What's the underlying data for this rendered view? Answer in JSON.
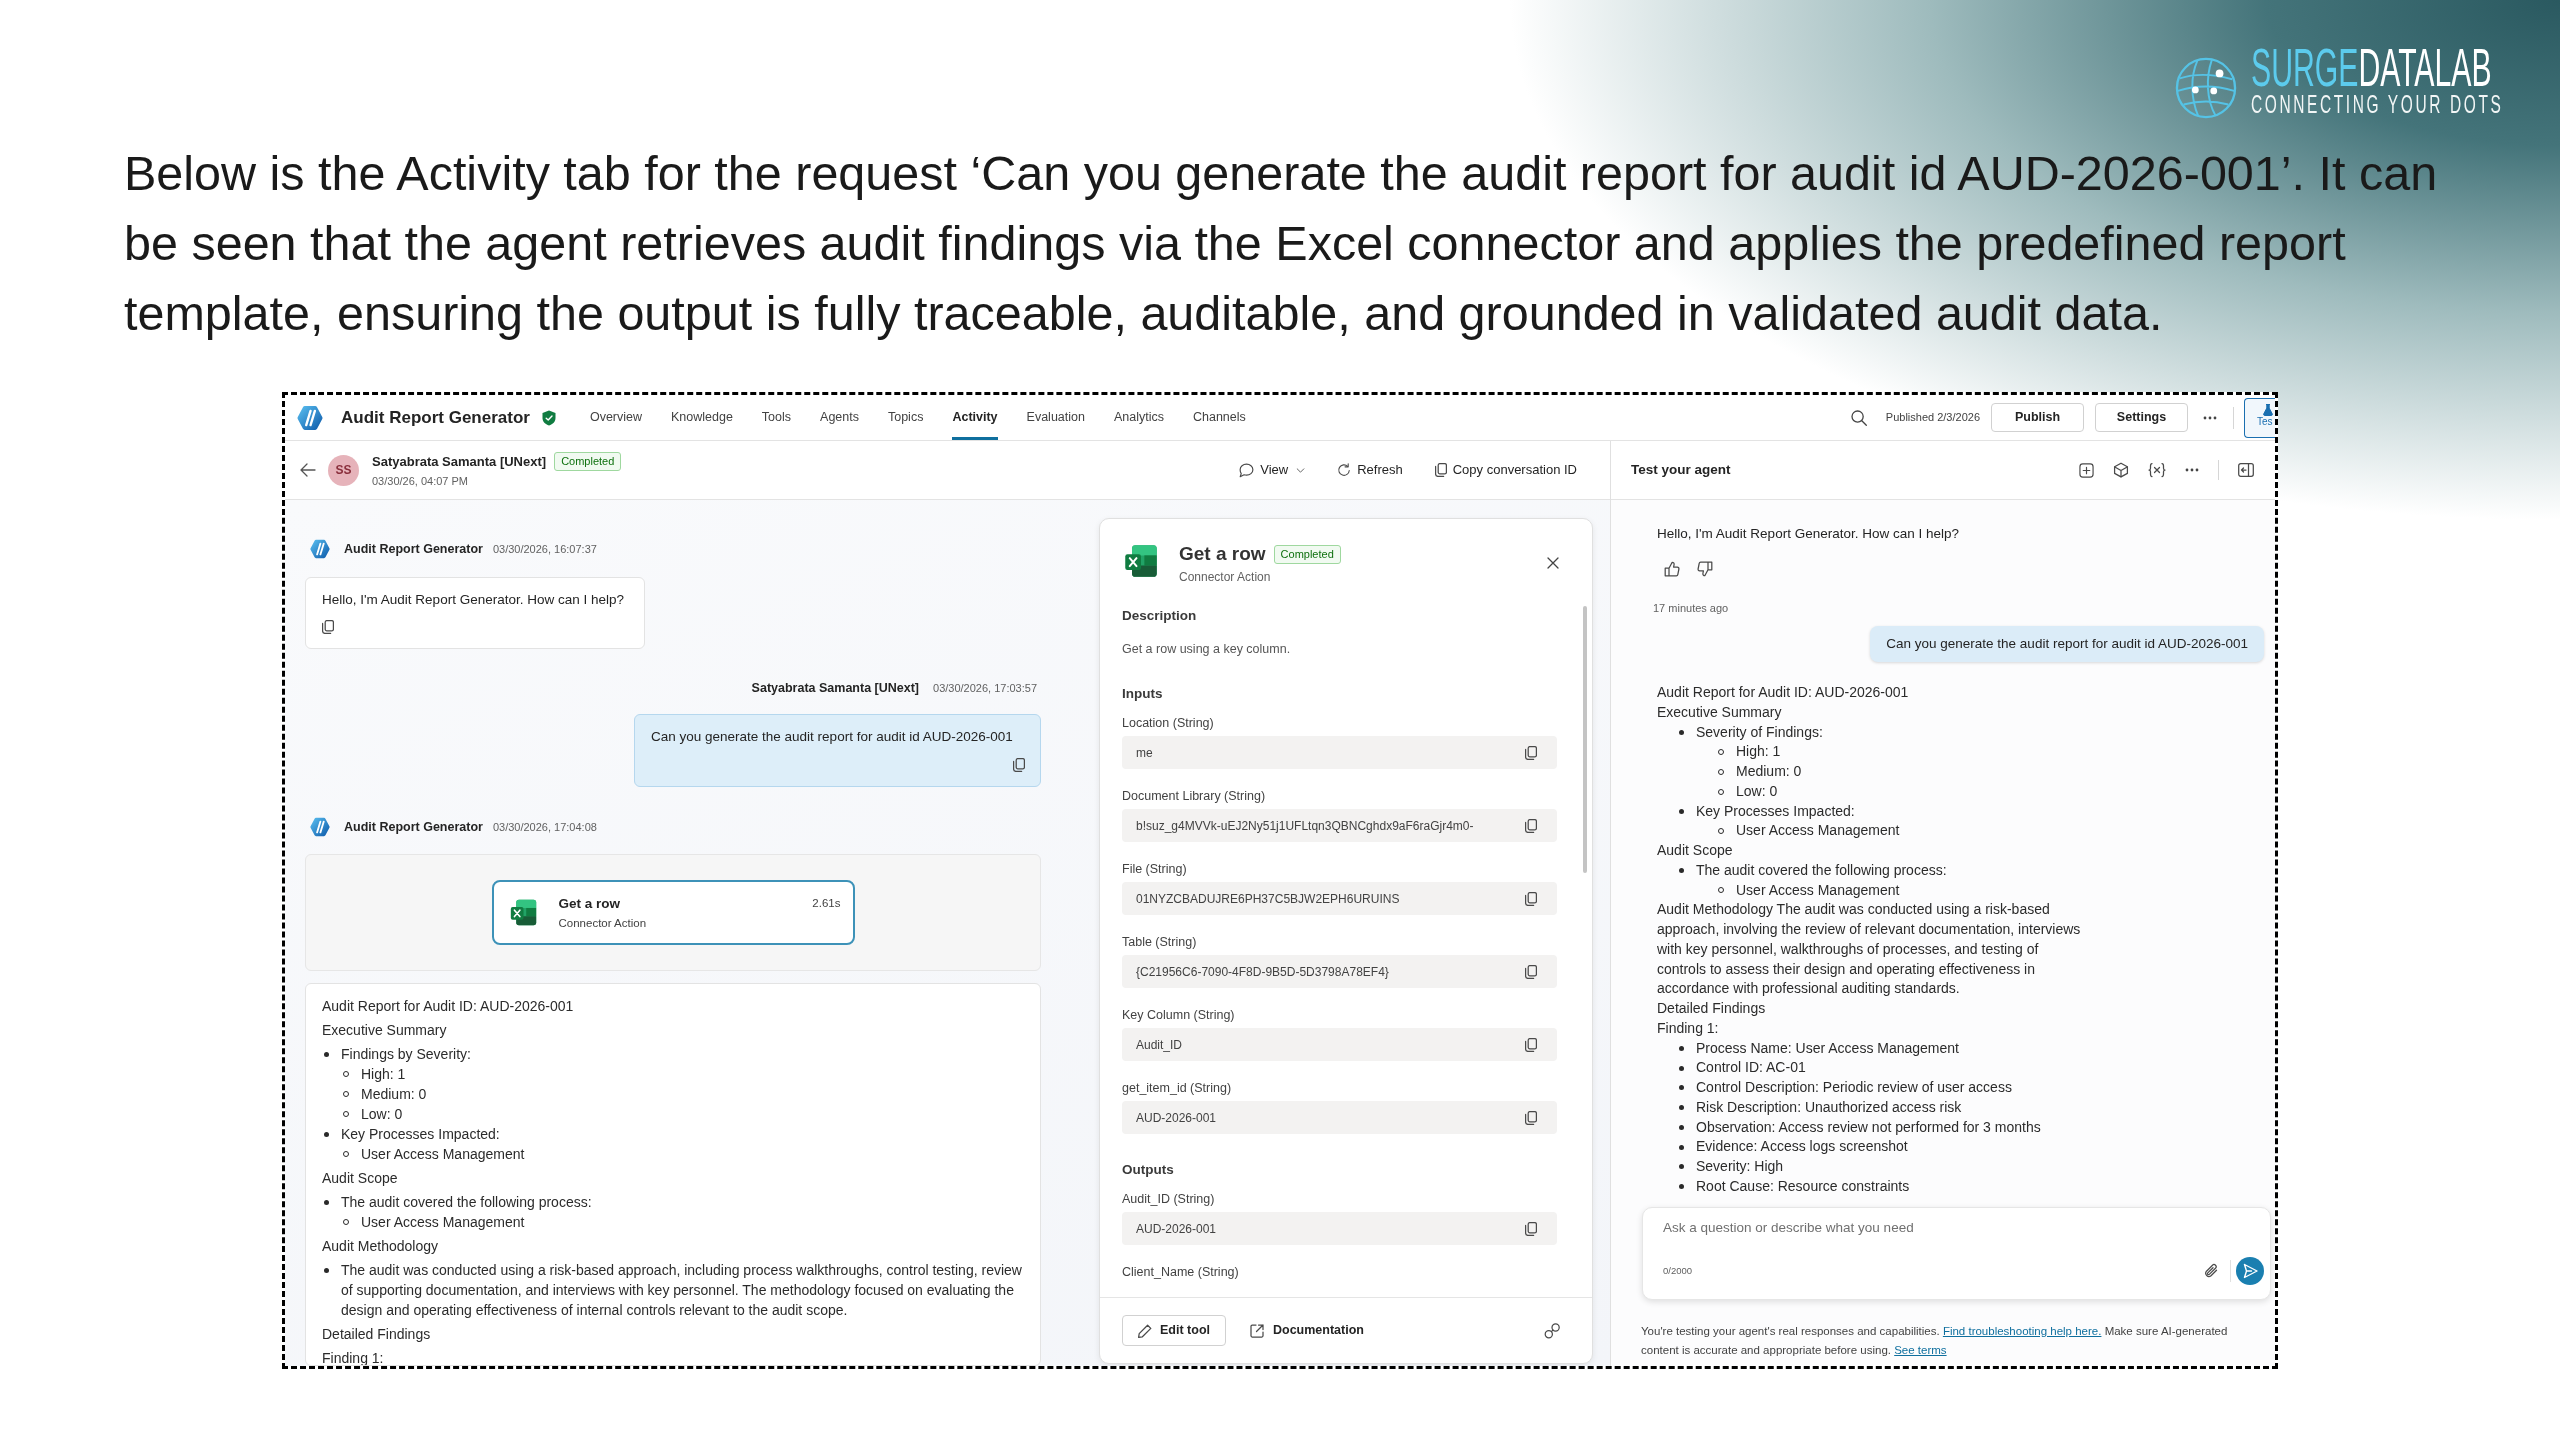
{
  "slide": {
    "caption": "Below is the Activity tab for the request ‘Can you generate the audit report for audit id AUD-2026-001’. It can be seen that the agent retrieves audit findings via the Excel connector and applies the predefined report template, ensuring the output is fully traceable, auditable, and grounded in validated audit data."
  },
  "logo": {
    "brand_1": "SURGE",
    "brand_2": "DATALAB",
    "tagline": "CONNECTING YOUR DOTS"
  },
  "app": {
    "title": "Audit Report Generator",
    "tabs": [
      {
        "label": "Overview",
        "selected": false
      },
      {
        "label": "Knowledge",
        "selected": false
      },
      {
        "label": "Tools",
        "selected": false
      },
      {
        "label": "Agents",
        "selected": false
      },
      {
        "label": "Topics",
        "selected": false
      },
      {
        "label": "Activity",
        "selected": true
      },
      {
        "label": "Evaluation",
        "selected": false
      },
      {
        "label": "Analytics",
        "selected": false
      },
      {
        "label": "Channels",
        "selected": false
      }
    ],
    "published": "Published 2/3/2026",
    "buttons": [
      {
        "label": "Publish"
      },
      {
        "label": "Settings"
      }
    ],
    "test_button": {
      "label": "Tes",
      "active": true
    }
  },
  "conversation": {
    "initials": "SS",
    "user": "Satyabrata Samanta [UNext]",
    "status": "Completed",
    "date": "03/30/26, 04:07 PM",
    "actions": [
      {
        "kind": "view",
        "label": "View"
      },
      {
        "kind": "refresh",
        "label": "Refresh"
      },
      {
        "kind": "copy",
        "label": "Copy conversation ID"
      }
    ]
  },
  "transcript": [
    {
      "kind": "bot",
      "author": "Audit Report Generator",
      "time": "03/30/2026, 16:07:37",
      "text": "Hello, I'm Audit Report Generator. How can I help?"
    },
    {
      "kind": "user",
      "author": "Satyabrata Samanta [UNext]",
      "time": "03/30/2026, 17:03:57",
      "text": "Can you generate the audit report for audit id AUD-2026-001"
    },
    {
      "kind": "bot",
      "author": "Audit Report Generator",
      "time": "03/30/2026, 17:04:08",
      "tool": {
        "name": "Get a row",
        "subtitle": "Connector Action",
        "duration": "2.61s",
        "selected": true
      },
      "report": [
        {
          "kind": "text",
          "text": "Audit Report for Audit ID: AUD-2026-001"
        },
        {
          "kind": "text",
          "text": "Executive Summary"
        },
        {
          "kind": "list",
          "items": [
            {
              "text": "Findings by Severity:",
              "children": [
                {
                  "text": "High: 1"
                },
                {
                  "text": "Medium: 0"
                },
                {
                  "text": "Low: 0"
                }
              ]
            },
            {
              "text": "Key Processes Impacted:",
              "children": [
                {
                  "text": "User Access Management"
                }
              ]
            }
          ]
        },
        {
          "kind": "text",
          "text": "Audit Scope"
        },
        {
          "kind": "list",
          "items": [
            {
              "text": "The audit covered the following process:",
              "children": [
                {
                  "text": "User Access Management"
                }
              ]
            }
          ]
        },
        {
          "kind": "text",
          "text": "Audit Methodology"
        },
        {
          "kind": "list",
          "items": [
            {
              "text": "The audit was conducted using a risk-based approach, including process walkthroughs, control testing, review of supporting documentation, and interviews with key personnel. The methodology focused on evaluating the design and operating effectiveness of internal controls relevant to the audit scope."
            }
          ]
        },
        {
          "kind": "text",
          "text": "Detailed Findings"
        },
        {
          "kind": "text",
          "text": "Finding 1:"
        }
      ]
    }
  ],
  "details": {
    "title": "Get a row",
    "status": "Completed",
    "subtitle": "Connector Action",
    "description": {
      "heading": "Description",
      "text": "Get a row using a key column."
    },
    "sections": [
      {
        "heading": "Inputs",
        "fields": [
          {
            "label": "Location (String)",
            "value": "me"
          },
          {
            "label": "Document Library (String)",
            "value": "b!suz_g4MVVk-uEJ2Ny51j1UFLtqn3QBNCghdx9aF6raGjr4m0-"
          },
          {
            "label": "File (String)",
            "value": "01NYZCBADUJRE6PH37C5BJW2EPH6URUINS"
          },
          {
            "label": "Table (String)",
            "value": "{C21956C6-7090-4F8D-9B5D-5D3798A78EF4}"
          },
          {
            "label": "Key Column (String)",
            "value": "Audit_ID"
          },
          {
            "label": "get_item_id (String)",
            "value": "AUD-2026-001"
          }
        ]
      },
      {
        "heading": "Outputs",
        "fields": [
          {
            "label": "Audit_ID (String)",
            "value": "AUD-2026-001"
          },
          {
            "label": "Client_Name (String)"
          }
        ]
      }
    ],
    "edit_button": "Edit tool",
    "docs_link": "Documentation"
  },
  "test_panel": {
    "title": "Test your agent",
    "messages": [
      {
        "kind": "bot",
        "text": "Hello, I'm Audit Report Generator. How can I help?",
        "time": "17 minutes ago"
      },
      {
        "kind": "user",
        "text": "Can you generate the audit report for audit id AUD-2026-001"
      },
      {
        "kind": "report",
        "blocks": [
          {
            "kind": "text",
            "text": "Audit Report for Audit ID: AUD-2026-001"
          },
          {
            "kind": "text",
            "text": "Executive Summary"
          },
          {
            "kind": "list",
            "items": [
              {
                "text": "Severity of Findings:",
                "children": [
                  {
                    "text": "High: 1"
                  },
                  {
                    "text": "Medium: 0"
                  },
                  {
                    "text": "Low: 0"
                  }
                ]
              },
              {
                "text": "Key Processes Impacted:",
                "children": [
                  {
                    "text": "User Access Management"
                  }
                ]
              }
            ]
          },
          {
            "kind": "text",
            "text": "Audit Scope"
          },
          {
            "kind": "list",
            "items": [
              {
                "text": "The audit covered the following process:",
                "children": [
                  {
                    "text": "User Access Management"
                  }
                ]
              }
            ]
          },
          {
            "kind": "text",
            "text": "Audit Methodology The audit was conducted using a risk-based approach, involving the review of relevant documentation, interviews with key personnel, walkthroughs of processes, and testing of controls to assess their design and operating effectiveness in accordance with professional auditing standards."
          },
          {
            "kind": "text",
            "text": "Detailed Findings"
          },
          {
            "kind": "text",
            "text": "Finding 1:"
          },
          {
            "kind": "list",
            "items": [
              {
                "text": "Process Name: User Access Management"
              },
              {
                "text": "Control ID: AC-01"
              },
              {
                "text": "Control Description: Periodic review of user access"
              },
              {
                "text": "Risk Description: Unauthorized access risk"
              },
              {
                "text": "Observation: Access review not performed for 3 months"
              },
              {
                "text": "Evidence: Access logs screenshot"
              },
              {
                "text": "Severity: High"
              },
              {
                "text": "Root Cause: Resource constraints"
              }
            ]
          }
        ]
      }
    ],
    "input": {
      "placeholder": "Ask a question or describe what you need",
      "counter": "0/2000"
    },
    "disclaimer": [
      {
        "kind": "text",
        "text": "You're testing your agent's real responses and capabilities. "
      },
      {
        "kind": "link",
        "text": "Find troubleshooting help here."
      },
      {
        "kind": "text",
        "text": " Make sure AI-generated content is accurate and appropriate before using. "
      },
      {
        "kind": "link",
        "text": "See terms"
      }
    ]
  }
}
